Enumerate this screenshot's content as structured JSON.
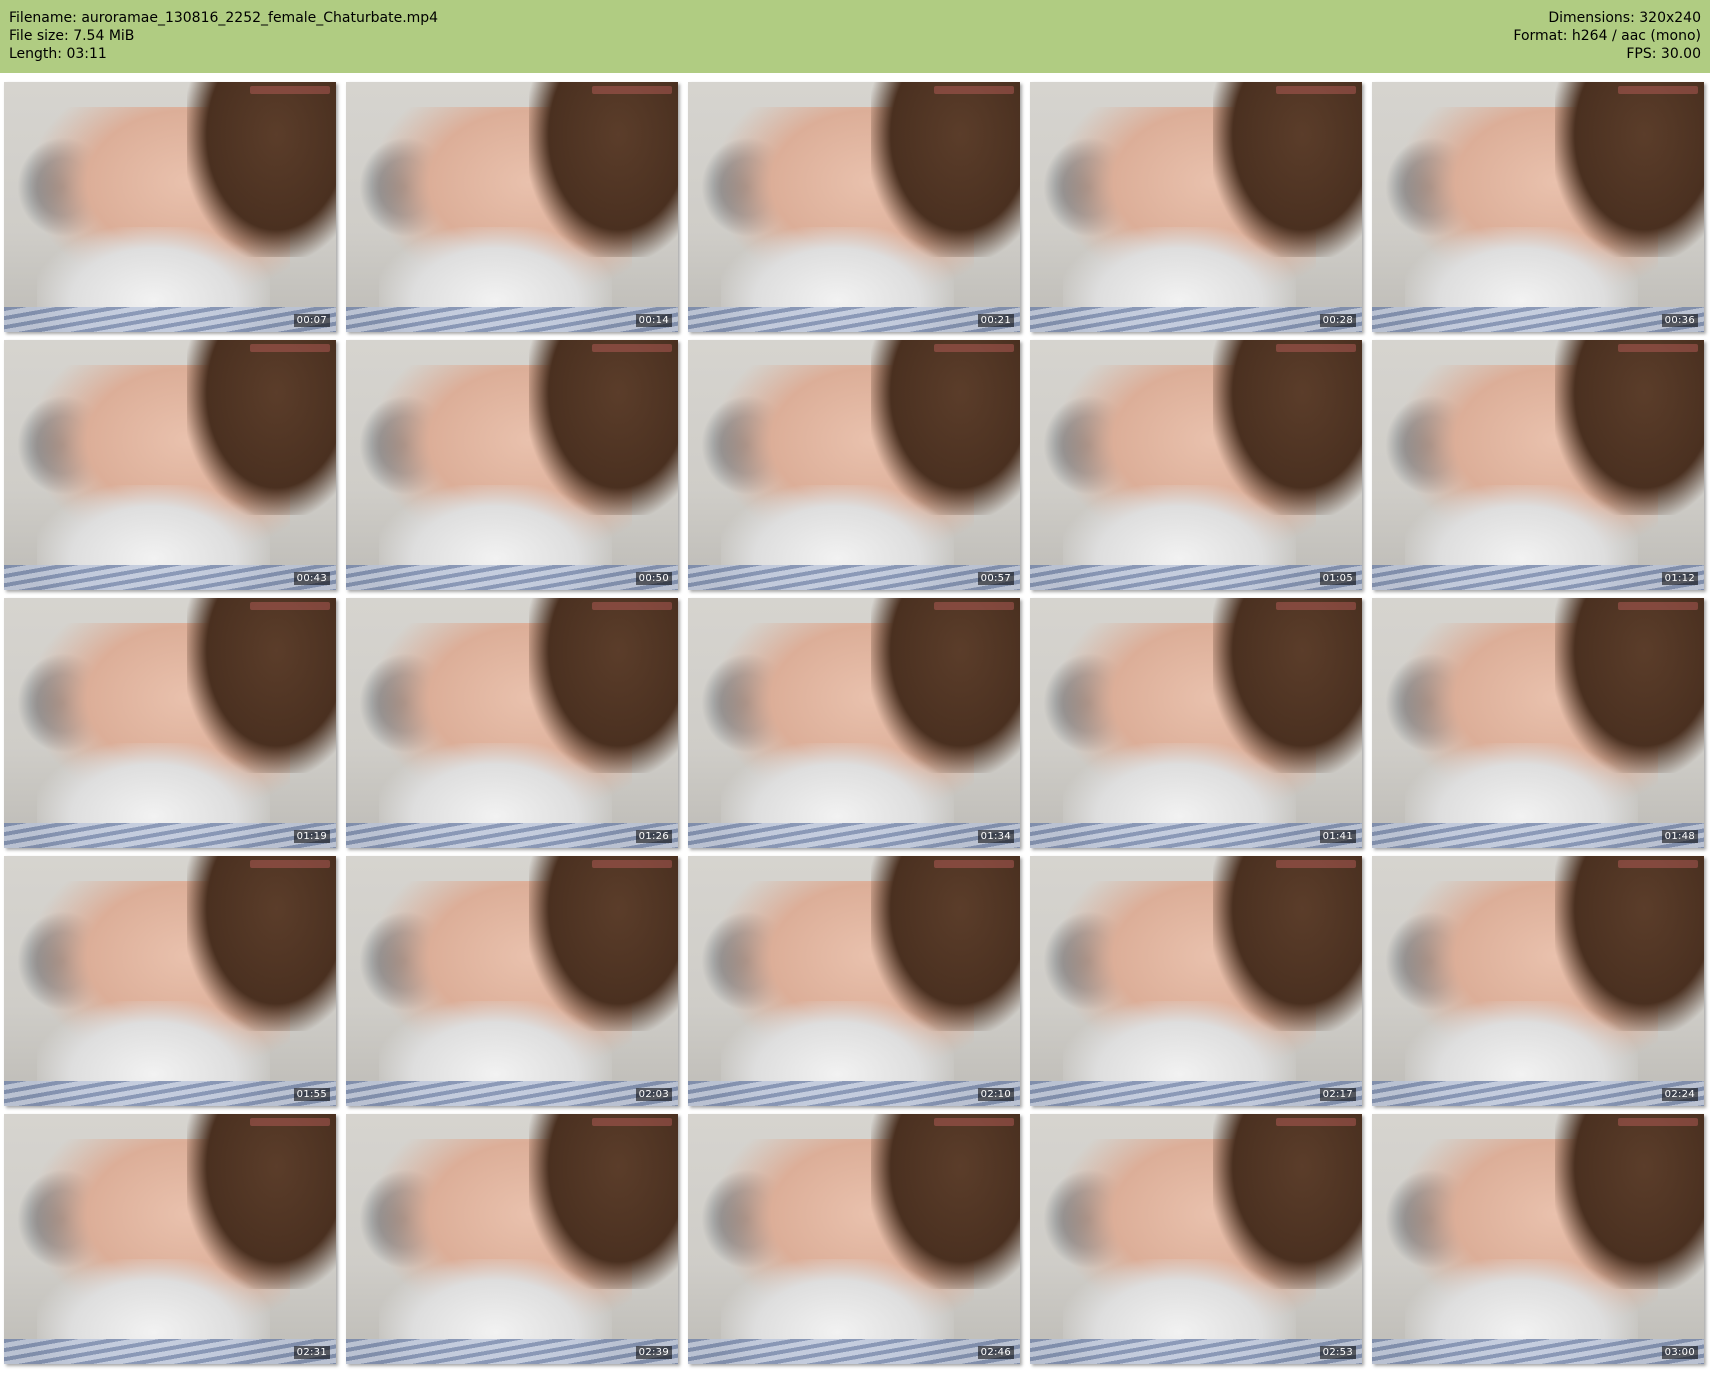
{
  "header": {
    "filename_label": "Filename:",
    "filename": "auroramae_130816_2252_female_Chaturbate.mp4",
    "filesize_label": "File size:",
    "filesize": "7.54 MiB",
    "length_label": "Length:",
    "length": "03:11",
    "dimensions_label": "Dimensions:",
    "dimensions": "320x240",
    "format_label": "Format:",
    "format": "h264 / aac (mono)",
    "fps_label": "FPS:",
    "fps": "30.00"
  },
  "colors": {
    "header_bg": "#b0cc82"
  },
  "thumbnails": [
    {
      "time": "00:07"
    },
    {
      "time": "00:14"
    },
    {
      "time": "00:21"
    },
    {
      "time": "00:28"
    },
    {
      "time": "00:36"
    },
    {
      "time": "00:43"
    },
    {
      "time": "00:50"
    },
    {
      "time": "00:57"
    },
    {
      "time": "01:05"
    },
    {
      "time": "01:12"
    },
    {
      "time": "01:19"
    },
    {
      "time": "01:26"
    },
    {
      "time": "01:34"
    },
    {
      "time": "01:41"
    },
    {
      "time": "01:48"
    },
    {
      "time": "01:55"
    },
    {
      "time": "02:03"
    },
    {
      "time": "02:10"
    },
    {
      "time": "02:17"
    },
    {
      "time": "02:24"
    },
    {
      "time": "02:31"
    },
    {
      "time": "02:39"
    },
    {
      "time": "02:46"
    },
    {
      "time": "02:53"
    },
    {
      "time": "03:00"
    }
  ]
}
